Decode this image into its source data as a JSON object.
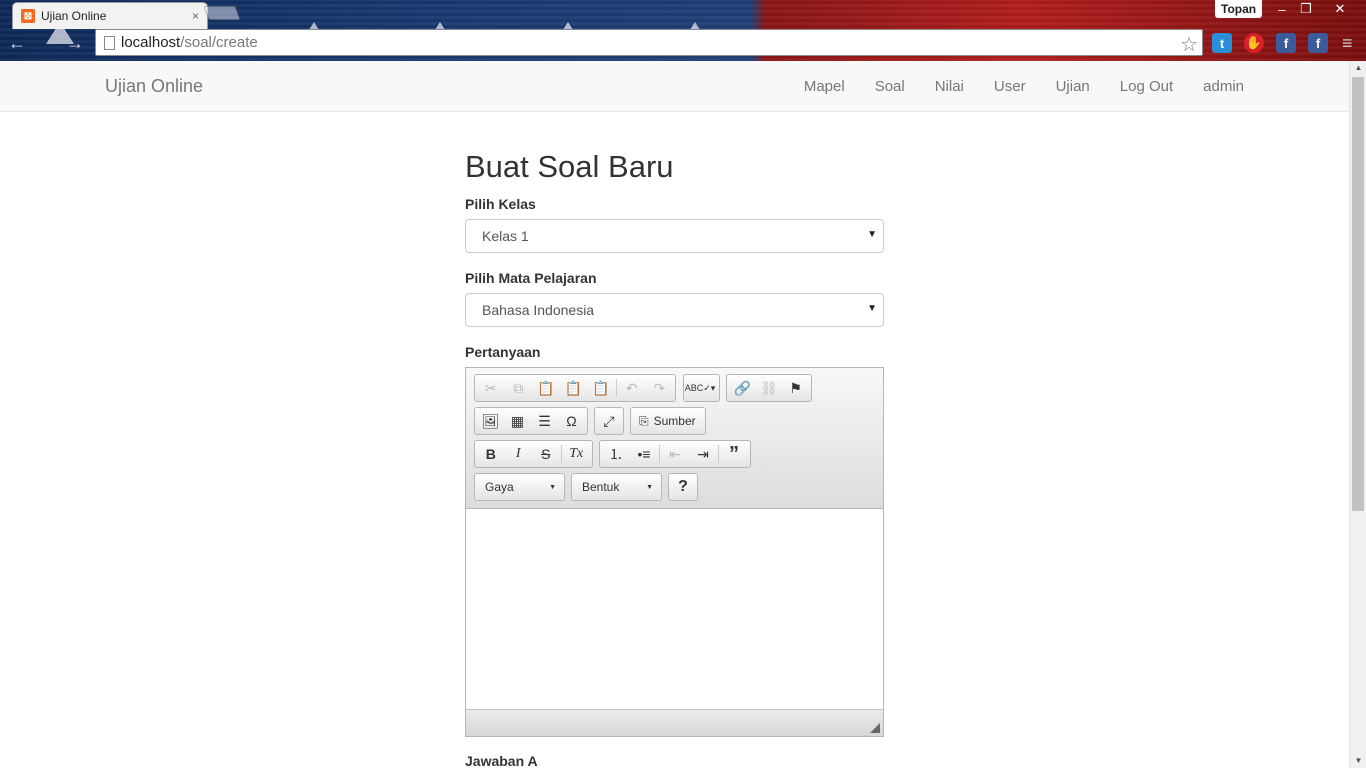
{
  "browser": {
    "tab_title": "Ujian Online",
    "tab_favicon": "xampp-icon",
    "tab_close": "×",
    "profile_name": "Topan",
    "window_controls": {
      "minimize": "–",
      "restore": "❐",
      "close": "✕"
    },
    "url_host": "localhost",
    "url_path": "/soal/create",
    "back": "←",
    "forward": "→",
    "bookmark_star": "☆",
    "extensions": [
      {
        "name": "twitter-icon",
        "glyph": "t",
        "color": "#2a8fd8"
      },
      {
        "name": "adblock-icon",
        "glyph": "✋",
        "color": "#d9202a"
      },
      {
        "name": "facebook-icon",
        "glyph": "f",
        "color": "#3b5b9a"
      },
      {
        "name": "facebook-icon",
        "glyph": "f",
        "color": "#3b5b9a"
      }
    ],
    "menu": "≡"
  },
  "navbar": {
    "brand": "Ujian Online",
    "links": [
      "Mapel",
      "Soal",
      "Nilai",
      "User",
      "Ujian",
      "Log Out",
      "admin"
    ]
  },
  "form": {
    "title": "Buat Soal Baru",
    "kelas_label": "Pilih Kelas",
    "kelas_value": "Kelas 1",
    "mapel_label": "Pilih Mata Pelajaran",
    "mapel_value": "Bahasa Indonesia",
    "pertanyaan_label": "Pertanyaan",
    "next_label": "Jawaban A"
  },
  "editor": {
    "source_label": "Sumber",
    "style_combo": "Gaya",
    "format_combo": "Bentuk",
    "help": "?",
    "bold": "B",
    "italic": "I",
    "strike": "S",
    "removeformat": "Tx"
  }
}
